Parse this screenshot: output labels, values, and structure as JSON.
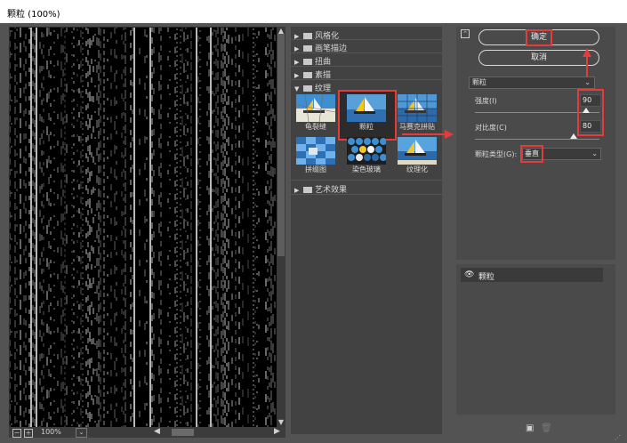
{
  "window": {
    "title": "颗粒 (100%)"
  },
  "preview": {
    "zoom": "100%"
  },
  "gallery": {
    "categories": [
      {
        "label": "风格化",
        "expanded": false
      },
      {
        "label": "画笔描边",
        "expanded": false
      },
      {
        "label": "扭曲",
        "expanded": false
      },
      {
        "label": "素描",
        "expanded": false
      },
      {
        "label": "纹理",
        "expanded": true
      }
    ],
    "texture_filters": [
      "龟裂缝",
      "颗粒",
      "马赛克拼贴",
      "拼缀图",
      "染色玻璃",
      "纹理化"
    ],
    "selected_filter": "颗粒",
    "last_category": "艺术效果"
  },
  "settings": {
    "ok_label": "确定",
    "cancel_label": "取消",
    "filter_select": "颗粒",
    "intensity_label": "强度(I)",
    "intensity_value": "90",
    "contrast_label": "对比度(C)",
    "contrast_value": "80",
    "type_label": "颗粒类型(G):",
    "type_value": "垂直"
  },
  "layers": {
    "items": [
      {
        "name": "颗粒"
      }
    ]
  },
  "colors": {
    "highlight": "#e43b3b",
    "panel": "#4a4a4a",
    "background": "#535353"
  }
}
